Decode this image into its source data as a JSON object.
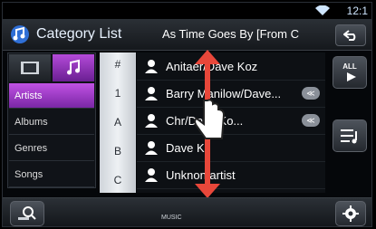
{
  "status": {
    "time": "12:1"
  },
  "header": {
    "title": "Category List",
    "track": "As Time Goes By [From C"
  },
  "tabs": [
    {
      "name": "video-tab"
    },
    {
      "name": "audio-tab"
    }
  ],
  "categories": [
    "Artists",
    "Albums",
    "Genres",
    "Songs"
  ],
  "index": [
    "#",
    "1",
    "A",
    "B",
    "C"
  ],
  "items": [
    {
      "label": "Anita",
      "suffix": "er/Dave Koz",
      "more": false
    },
    {
      "label": "Barry Manilow/Dave...",
      "more": true
    },
    {
      "label": "Chr",
      "suffix": "/Dave Ko...",
      "more": true
    },
    {
      "label": "Dave K",
      "suffix": "z",
      "more": false
    },
    {
      "label": "Unkno",
      "suffix": "n artist",
      "more": false
    }
  ],
  "side": {
    "all_label_1": "ALL",
    "all_label_2": ""
  },
  "bottom": {
    "source": "MUSIC"
  },
  "colors": {
    "accent": "#a83fd1",
    "gesture": "#e8473a"
  }
}
